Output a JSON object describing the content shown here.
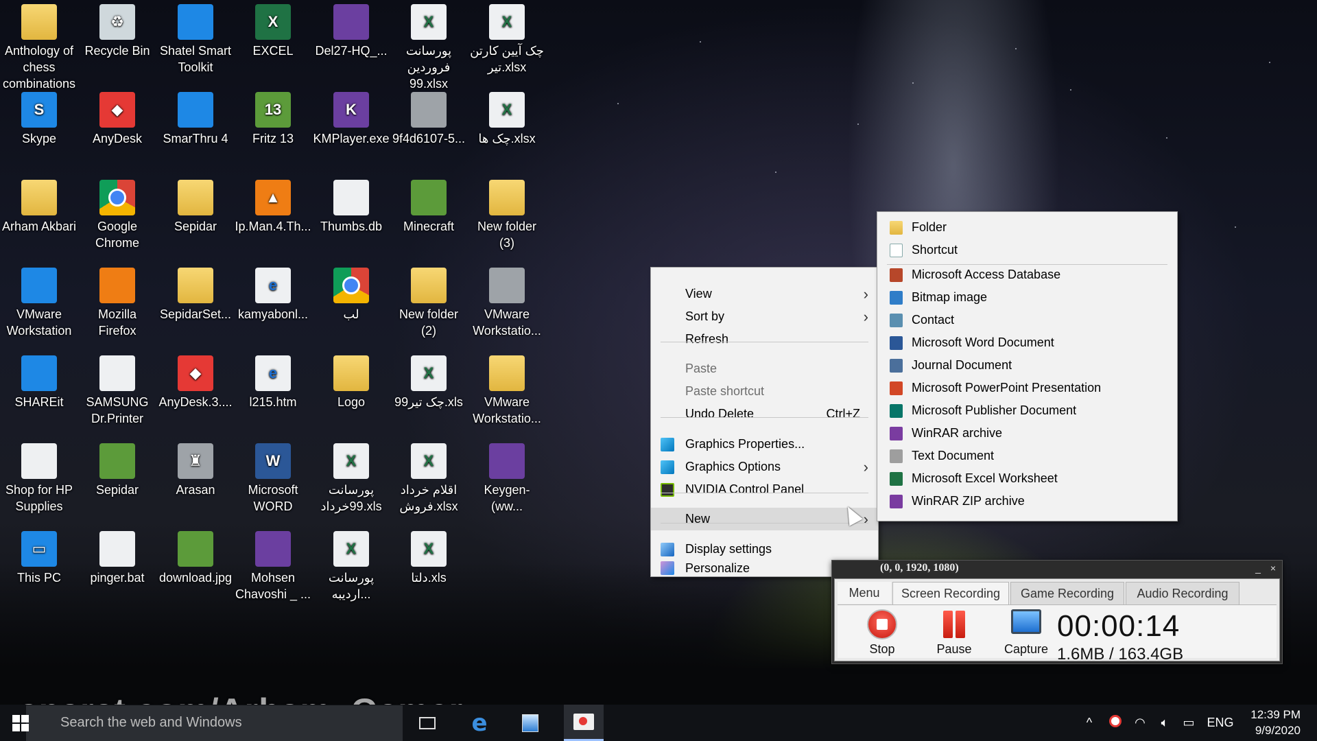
{
  "desktop": {
    "icons": [
      {
        "label": "Anthology of chess combinations",
        "glyph": "folder-icon"
      },
      {
        "label": "Recycle Bin",
        "glyph": "recycle-bin-icon"
      },
      {
        "label": "Shatel Smart Toolkit",
        "glyph": "shatel-icon"
      },
      {
        "label": "EXCEL",
        "glyph": "excel-icon"
      },
      {
        "label": "Del27-HQ_...",
        "glyph": "winrar-icon"
      },
      {
        "label": "پورسانت فروردین 99.xlsx",
        "glyph": "excel-file-icon"
      },
      {
        "label": "چک آیین کارتن تیر.xlsx",
        "glyph": "excel-file-icon"
      },
      {
        "label": "Skype",
        "glyph": "skype-icon"
      },
      {
        "label": "AnyDesk",
        "glyph": "anydesk-icon"
      },
      {
        "label": "SmarThru 4",
        "glyph": "smarthru-icon"
      },
      {
        "label": "Fritz 13",
        "glyph": "fritz-icon"
      },
      {
        "label": "KMPlayer.exe",
        "glyph": "kmplayer-icon"
      },
      {
        "label": "9f4d6107-5...",
        "glyph": "file-icon"
      },
      {
        "label": "چک ها.xlsx",
        "glyph": "excel-file-icon"
      },
      {
        "label": "Arham Akbari",
        "glyph": "user-folder-icon"
      },
      {
        "label": "Google Chrome",
        "glyph": "chrome-icon"
      },
      {
        "label": "Sepidar",
        "glyph": "folder-icon"
      },
      {
        "label": "Ip.Man.4.Th...",
        "glyph": "vlc-icon"
      },
      {
        "label": "Thumbs.db",
        "glyph": "settings-file-icon"
      },
      {
        "label": "Minecraft",
        "glyph": "minecraft-icon"
      },
      {
        "label": "New folder (3)",
        "glyph": "folder-icon"
      },
      {
        "label": "VMware Workstation",
        "glyph": "vmware-icon"
      },
      {
        "label": "Mozilla Firefox",
        "glyph": "firefox-icon"
      },
      {
        "label": "SepidarSet...",
        "glyph": "folder-icon"
      },
      {
        "label": "kamyabonl...",
        "glyph": "edge-file-icon"
      },
      {
        "label": "لب",
        "glyph": "chrome-icon"
      },
      {
        "label": "New folder (2)",
        "glyph": "folder-icon"
      },
      {
        "label": "VMware Workstatio...",
        "glyph": "file-icon"
      },
      {
        "label": "SHAREit",
        "glyph": "shareit-icon"
      },
      {
        "label": "SAMSUNG Dr.Printer",
        "glyph": "printer-icon"
      },
      {
        "label": "AnyDesk.3....",
        "glyph": "anydesk-icon"
      },
      {
        "label": "l215.htm",
        "glyph": "edge-file-icon"
      },
      {
        "label": "Logo",
        "glyph": "folder-icon"
      },
      {
        "label": "چک تیر99.xls",
        "glyph": "excel-file-icon"
      },
      {
        "label": "VMware Workstatio...",
        "glyph": "folder-icon"
      },
      {
        "label": "Shop for HP Supplies",
        "glyph": "hp-shop-icon"
      },
      {
        "label": "Sepidar",
        "glyph": "sepidar-icon"
      },
      {
        "label": "Arasan",
        "glyph": "chess-icon"
      },
      {
        "label": "Microsoft WORD",
        "glyph": "word-icon"
      },
      {
        "label": "پورسانت 99خرداد.xls",
        "glyph": "excel-file-icon"
      },
      {
        "label": "اقلام خرداد فروش.xlsx",
        "glyph": "excel-file-icon"
      },
      {
        "label": "Keygen-(ww...",
        "glyph": "keygen-icon"
      },
      {
        "label": "This PC",
        "glyph": "this-pc-icon"
      },
      {
        "label": "pinger.bat",
        "glyph": "batch-file-icon"
      },
      {
        "label": "download.jpg",
        "glyph": "image-file-icon"
      },
      {
        "label": "Mohsen Chavoshi _ ...",
        "glyph": "music-file-icon"
      },
      {
        "label": "پورسانت اردیبه...",
        "glyph": "excel-file-icon"
      },
      {
        "label": "دلتا.xls",
        "glyph": "excel-file-icon"
      }
    ]
  },
  "context_menu": {
    "view": "View",
    "sort_by": "Sort by",
    "refresh": "Refresh",
    "paste": "Paste",
    "paste_shortcut": "Paste shortcut",
    "undo_delete": "Undo Delete",
    "undo_delete_shortcut": "Ctrl+Z",
    "graphics_properties": "Graphics Properties...",
    "graphics_options": "Graphics Options",
    "nvidia_control_panel": "NVIDIA Control Panel",
    "new": "New",
    "display_settings": "Display settings",
    "personalize": "Personalize"
  },
  "new_submenu": {
    "folder": "Folder",
    "shortcut": "Shortcut",
    "items": [
      "Microsoft Access Database",
      "Bitmap image",
      "Contact",
      "Microsoft Word Document",
      "Journal Document",
      "Microsoft PowerPoint Presentation",
      "Microsoft Publisher Document",
      "WinRAR archive",
      "Text Document",
      "Microsoft Excel Worksheet",
      "WinRAR ZIP archive"
    ]
  },
  "recorder": {
    "title": "(0, 0, 1920, 1080)",
    "minimize": "_",
    "close": "×",
    "menu_tab": "Menu",
    "tabs": [
      "Screen Recording",
      "Game Recording",
      "Audio Recording"
    ],
    "stop": "Stop",
    "pause": "Pause",
    "capture": "Capture",
    "timer": "00:00:14",
    "size": "1.6MB / 163.4GB"
  },
  "taskbar": {
    "search_placeholder": "Search the web and Windows",
    "language": "ENG",
    "time": "12:39 PM",
    "date": "9/9/2020",
    "tray_chevron": "^"
  },
  "watermark": "aparat.com/Arham_Gamer",
  "colors": {
    "menu_bg": "#f2f2f2",
    "menu_hover": "#dadada",
    "taskbar_bg": "#101216",
    "recorder_red": "#e53935"
  }
}
